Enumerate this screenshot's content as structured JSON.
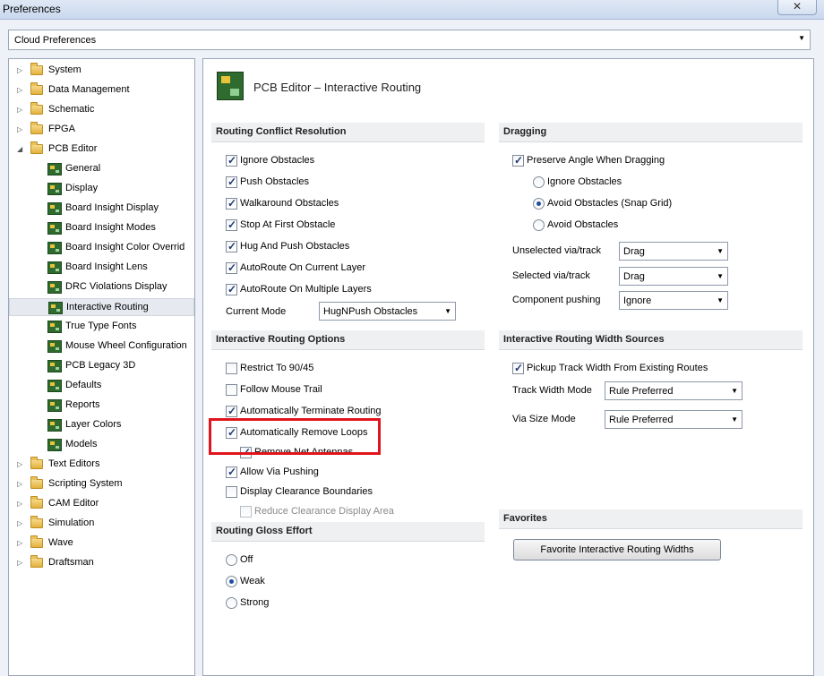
{
  "window": {
    "title": "Preferences",
    "close_glyph": "✕"
  },
  "top_dropdown": {
    "value": "Cloud Preferences"
  },
  "tree": {
    "items": [
      {
        "label": "System",
        "type": "folder",
        "expanded": false
      },
      {
        "label": "Data Management",
        "type": "folder",
        "expanded": false
      },
      {
        "label": "Schematic",
        "type": "folder",
        "expanded": false
      },
      {
        "label": "FPGA",
        "type": "folder",
        "expanded": false
      },
      {
        "label": "PCB Editor",
        "type": "folder",
        "expanded": true
      },
      {
        "label": "General",
        "type": "page"
      },
      {
        "label": "Display",
        "type": "page"
      },
      {
        "label": "Board Insight Display",
        "type": "page"
      },
      {
        "label": "Board Insight Modes",
        "type": "page"
      },
      {
        "label": "Board Insight Color Overrid",
        "type": "page"
      },
      {
        "label": "Board Insight Lens",
        "type": "page"
      },
      {
        "label": "DRC Violations Display",
        "type": "page"
      },
      {
        "label": "Interactive Routing",
        "type": "page",
        "selected": true
      },
      {
        "label": "True Type Fonts",
        "type": "page"
      },
      {
        "label": "Mouse Wheel Configuration",
        "type": "page"
      },
      {
        "label": "PCB Legacy 3D",
        "type": "page"
      },
      {
        "label": "Defaults",
        "type": "page"
      },
      {
        "label": "Reports",
        "type": "page"
      },
      {
        "label": "Layer Colors",
        "type": "page"
      },
      {
        "label": "Models",
        "type": "page"
      },
      {
        "label": "Text Editors",
        "type": "folder",
        "expanded": false
      },
      {
        "label": "Scripting System",
        "type": "folder",
        "expanded": false
      },
      {
        "label": "CAM Editor",
        "type": "folder",
        "expanded": false
      },
      {
        "label": "Simulation",
        "type": "folder",
        "expanded": false
      },
      {
        "label": "Wave",
        "type": "folder",
        "expanded": false
      },
      {
        "label": "Draftsman",
        "type": "folder",
        "expanded": false
      }
    ]
  },
  "page_title": "PCB Editor – Interactive Routing",
  "conflict": {
    "header": "Routing Conflict Resolution",
    "options": [
      {
        "label": "Ignore Obstacles",
        "checked": true
      },
      {
        "label": "Push Obstacles",
        "checked": true
      },
      {
        "label": "Walkaround Obstacles",
        "checked": true
      },
      {
        "label": "Stop At First Obstacle",
        "checked": true
      },
      {
        "label": "Hug And Push Obstacles",
        "checked": true
      },
      {
        "label": "AutoRoute On Current Layer",
        "checked": true
      },
      {
        "label": "AutoRoute On Multiple Layers",
        "checked": true
      }
    ],
    "current_mode_label": "Current Mode",
    "current_mode_value": "HugNPush Obstacles"
  },
  "routing_options": {
    "header": "Interactive Routing Options",
    "options": [
      {
        "label": "Restrict To 90/45",
        "checked": false
      },
      {
        "label": "Follow Mouse Trail",
        "checked": false
      },
      {
        "label": "Automatically Terminate Routing",
        "checked": true
      },
      {
        "label": "Automatically Remove Loops",
        "checked": true
      },
      {
        "label": "Remove Net Antennas",
        "checked": true
      },
      {
        "label": "Allow Via Pushing",
        "checked": true
      },
      {
        "label": "Display Clearance Boundaries",
        "checked": false
      },
      {
        "label": "Reduce Clearance Display Area",
        "checked": false,
        "disabled": true
      }
    ]
  },
  "gloss": {
    "header": "Routing Gloss Effort",
    "options": [
      {
        "label": "Off",
        "checked": false
      },
      {
        "label": "Weak",
        "checked": true
      },
      {
        "label": "Strong",
        "checked": false
      }
    ]
  },
  "dragging": {
    "header": "Dragging",
    "preserve_angle": {
      "label": "Preserve Angle When Dragging",
      "checked": true
    },
    "radios": [
      {
        "label": "Ignore Obstacles",
        "checked": false
      },
      {
        "label": "Avoid Obstacles (Snap Grid)",
        "checked": true
      },
      {
        "label": "Avoid Obstacles",
        "checked": false
      }
    ],
    "unselected_via": {
      "label": "Unselected via/track",
      "value": "Drag"
    },
    "selected_via": {
      "label": "Selected via/track",
      "value": "Drag"
    },
    "component_pushing": {
      "label": "Component pushing",
      "value": "Ignore"
    }
  },
  "width_sources": {
    "header": "Interactive Routing Width Sources",
    "pickup": {
      "label": "Pickup Track Width From Existing Routes",
      "checked": true
    },
    "track_width_mode": {
      "label": "Track Width Mode",
      "value": "Rule Preferred"
    },
    "via_size_mode": {
      "label": "Via Size Mode",
      "value": "Rule Preferred"
    }
  },
  "favorites": {
    "header": "Favorites",
    "button": "Favorite Interactive Routing Widths"
  },
  "colors": {
    "highlight": "#e0141c"
  }
}
